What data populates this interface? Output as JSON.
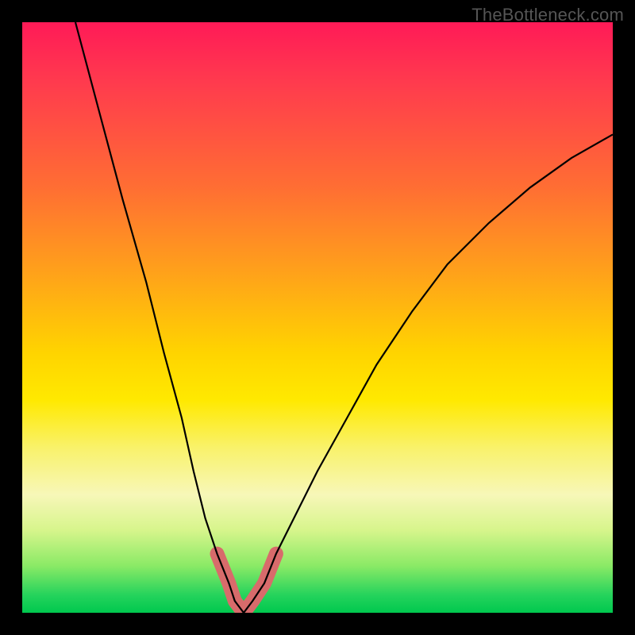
{
  "watermark": "TheBottleneck.com",
  "chart_data": {
    "type": "line",
    "title": "",
    "xlabel": "",
    "ylabel": "",
    "xlim": [
      0,
      100
    ],
    "ylim": [
      0,
      100
    ],
    "series": [
      {
        "name": "bottleneck-curve",
        "x": [
          9,
          13,
          17,
          21,
          24,
          27,
          29,
          31,
          33,
          35,
          36,
          37.5,
          39,
          41,
          43,
          46,
          50,
          55,
          60,
          66,
          72,
          79,
          86,
          93,
          100
        ],
        "y": [
          100,
          85,
          70,
          56,
          44,
          33,
          24,
          16,
          10,
          5,
          2,
          0,
          2,
          5,
          10,
          16,
          24,
          33,
          42,
          51,
          59,
          66,
          72,
          77,
          81
        ]
      }
    ],
    "highlight": {
      "name": "minimum-segment",
      "x_range": [
        33,
        43
      ],
      "y_max": 12
    }
  }
}
